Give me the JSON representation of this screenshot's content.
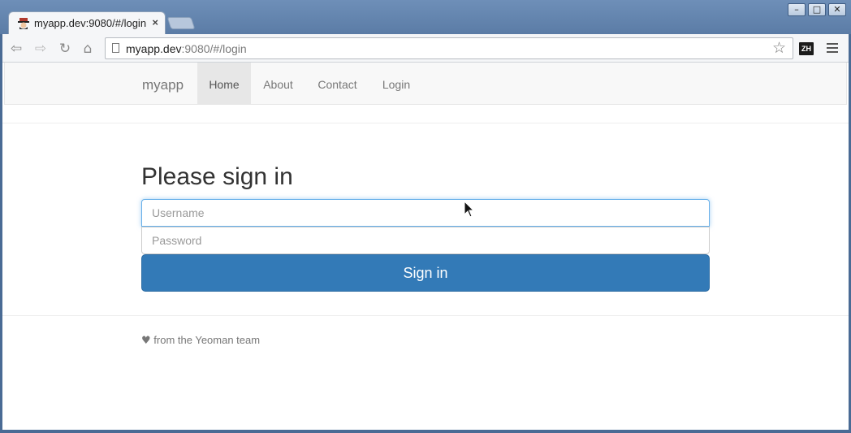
{
  "browser": {
    "tab_title": "myapp.dev:9080/#/login",
    "tab_close": "×",
    "url_host": "myapp.dev",
    "url_rest": ":9080/#/login",
    "window_buttons": [
      "–",
      "□",
      "✕"
    ],
    "nav_icons": {
      "back": "⇦",
      "forward": "⇨",
      "reload": "↻",
      "home": "⌂",
      "star": "☆"
    },
    "extension_label": "ZH"
  },
  "navbar": {
    "brand": "myapp",
    "items": [
      {
        "label": "Home",
        "active": true
      },
      {
        "label": "About",
        "active": false
      },
      {
        "label": "Contact",
        "active": false
      },
      {
        "label": "Login",
        "active": false
      }
    ]
  },
  "login": {
    "heading": "Please sign in",
    "username_placeholder": "Username",
    "password_placeholder": "Password",
    "submit_label": "Sign in"
  },
  "footer": {
    "heart": "♥",
    "text": "from the Yeoman team"
  },
  "colors": {
    "primary": "#337ab7",
    "focus": "#66afe9",
    "navbar_bg": "#f8f8f8"
  }
}
